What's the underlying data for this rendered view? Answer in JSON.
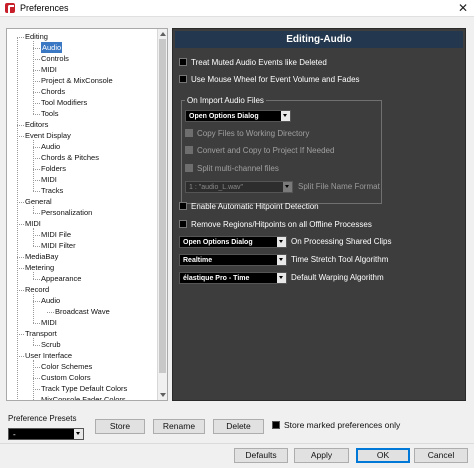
{
  "window": {
    "title": "Preferences",
    "close_glyph": "✕"
  },
  "tree": {
    "items": [
      {
        "label": "Editing",
        "indent": 0
      },
      {
        "label": "Audio",
        "indent": 1,
        "selected": true
      },
      {
        "label": "Controls",
        "indent": 1
      },
      {
        "label": "MIDI",
        "indent": 1
      },
      {
        "label": "Project & MixConsole",
        "indent": 1
      },
      {
        "label": "Chords",
        "indent": 1
      },
      {
        "label": "Tool Modifiers",
        "indent": 1
      },
      {
        "label": "Tools",
        "indent": 1
      },
      {
        "label": "Editors",
        "indent": 0
      },
      {
        "label": "Event Display",
        "indent": 0
      },
      {
        "label": "Audio",
        "indent": 1
      },
      {
        "label": "Chords & Pitches",
        "indent": 1
      },
      {
        "label": "Folders",
        "indent": 1
      },
      {
        "label": "MIDI",
        "indent": 1
      },
      {
        "label": "Tracks",
        "indent": 1
      },
      {
        "label": "General",
        "indent": 0
      },
      {
        "label": "Personalization",
        "indent": 1
      },
      {
        "label": "MIDI",
        "indent": 0
      },
      {
        "label": "MIDI File",
        "indent": 1
      },
      {
        "label": "MIDI Filter",
        "indent": 1
      },
      {
        "label": "MediaBay",
        "indent": 0
      },
      {
        "label": "Metering",
        "indent": 0
      },
      {
        "label": "Appearance",
        "indent": 1
      },
      {
        "label": "Record",
        "indent": 0
      },
      {
        "label": "Audio",
        "indent": 1
      },
      {
        "label": "Broadcast Wave",
        "indent": 2
      },
      {
        "label": "MIDI",
        "indent": 1
      },
      {
        "label": "Transport",
        "indent": 0
      },
      {
        "label": "Scrub",
        "indent": 1
      },
      {
        "label": "User Interface",
        "indent": 0
      },
      {
        "label": "Color Schemes",
        "indent": 1
      },
      {
        "label": "Custom Colors",
        "indent": 1
      },
      {
        "label": "Track Type Default Colors",
        "indent": 1
      },
      {
        "label": "MixConsole Fader Colors",
        "indent": 1
      }
    ]
  },
  "settings": {
    "header": "Editing-Audio",
    "treat_muted": "Treat Muted Audio Events like Deleted",
    "mouse_wheel": "Use Mouse Wheel for Event Volume and Fades",
    "import_group": {
      "label": "On Import Audio Files",
      "mode_value": "Open Options Dialog",
      "copy_files": "Copy Files to Working Directory",
      "convert_copy": "Convert and Copy to Project If Needed",
      "split_multichannel": "Split multi-channel files",
      "split_format_value": "1 : \"audio_L.wav\"",
      "split_format_label": "Split File Name Format"
    },
    "auto_hitpoint": "Enable Automatic Hitpoint Detection",
    "remove_regions": "Remove Regions/Hitpoints on all Offline Processes",
    "shared_clips_value": "Open Options Dialog",
    "shared_clips_label": "On Processing Shared Clips",
    "timestretch_value": "Realtime",
    "timestretch_label": "Time Stretch Tool Algorithm",
    "warping_value": "élastique Pro - Time",
    "warping_label": "Default Warping Algorithm"
  },
  "presets": {
    "label": "Preference Presets",
    "value": "-",
    "store": "Store",
    "rename": "Rename",
    "delete": "Delete",
    "store_marked": "Store marked preferences only"
  },
  "buttons": {
    "defaults": "Defaults",
    "apply": "Apply",
    "ok": "OK",
    "cancel": "Cancel"
  }
}
